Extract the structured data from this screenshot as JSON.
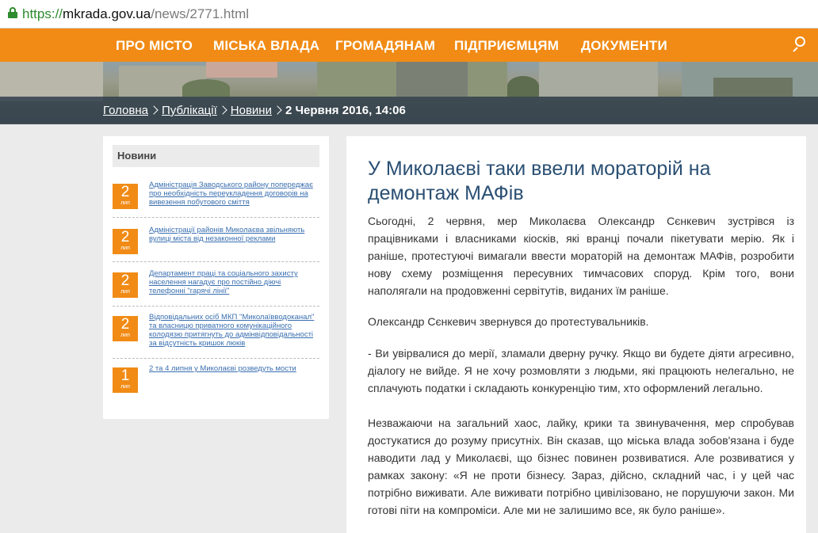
{
  "address_bar": {
    "scheme": "https://",
    "host": "mkrada.gov.ua",
    "path": "/news/2771.html"
  },
  "nav": {
    "items": [
      "ПРО МІСТО",
      "МІСЬКА ВЛАДА",
      "ГРОМАДЯНАМ",
      "ПІДПРИЄМЦЯМ",
      "ДОКУМЕНТИ"
    ],
    "search_icon": "search-icon"
  },
  "breadcrumb": {
    "home": "Головна",
    "publications": "Публікації",
    "news": "Новини",
    "current": "2 Червня 2016, 14:06"
  },
  "sidebar": {
    "title": "Новини",
    "items": [
      {
        "day": "2",
        "month": "лип",
        "title": "Адміністрація Заводського району попереджає про необхідність переукладення договорів на вивезення побутового сміття"
      },
      {
        "day": "2",
        "month": "лип",
        "title": "Адміністрації районів Миколаєва звільняють вулиці міста від незаконної реклами"
      },
      {
        "day": "2",
        "month": "лип",
        "title": "Департамент праці та соціального захисту населення нагадує про постійно діючі телефонні \"гарячі лінії\""
      },
      {
        "day": "2",
        "month": "лип",
        "title": "Відповідальних осіб МКП \"Миколаївводоканал\" та власницю приватного комунікаційного колодязю притягнуть до адмінвідповідальності за відсутність кришок люків"
      },
      {
        "day": "1",
        "month": "лип",
        "title": "2 та 4 липня у Миколаєві розведуть мости"
      }
    ]
  },
  "article": {
    "title": "У Миколаєві таки ввели мораторій на демонтаж МАФів",
    "paragraphs": [
      "Сьогодні, 2 червня, мер Миколаєва Олександр Сєнкевич зустрівся із працівниками і власниками кіосків, які вранці почали пікетувати мерію. Як і раніше, протестуючі вимагали ввести мораторій на демонтаж МАФів, розробити нову схему розміщення пересувних тимчасових споруд. Крім того, вони наполягали на продовженні сервітутів, виданих їм раніше.",
      "Олександр Сєнкевич звернувся до протестувальників.",
      "- Ви увірвалися до мерії, зламали дверну ручку. Якщо ви будете діяти агресивно, діалогу не вийде. Я не хочу розмовляти з людьми, які працюють нелегально, не сплачують податки і складають конкуренцію тим, хто оформлений легально.",
      "Незважаючи на загальний хаос, лайку, крики та звинувачення, мер спробував достукатися до розуму присутніх. Він сказав, що міська влада зобов'язана і буде наводити лад у Миколаєві, що бізнес повинен розвиватися. Але розвиватися у рамках закону: «Я не проти бізнесу. Зараз, дійсно, складний час, і у цей час потрібно виживати. Але виживати потрібно цивілізовано, не порушуючи закон. Ми готові піти на компроміси. Але ми не залишимо все, як було раніше»."
    ]
  },
  "colors": {
    "accent": "#f18b15",
    "title": "#2a4f73",
    "link": "#3a6fb0"
  }
}
